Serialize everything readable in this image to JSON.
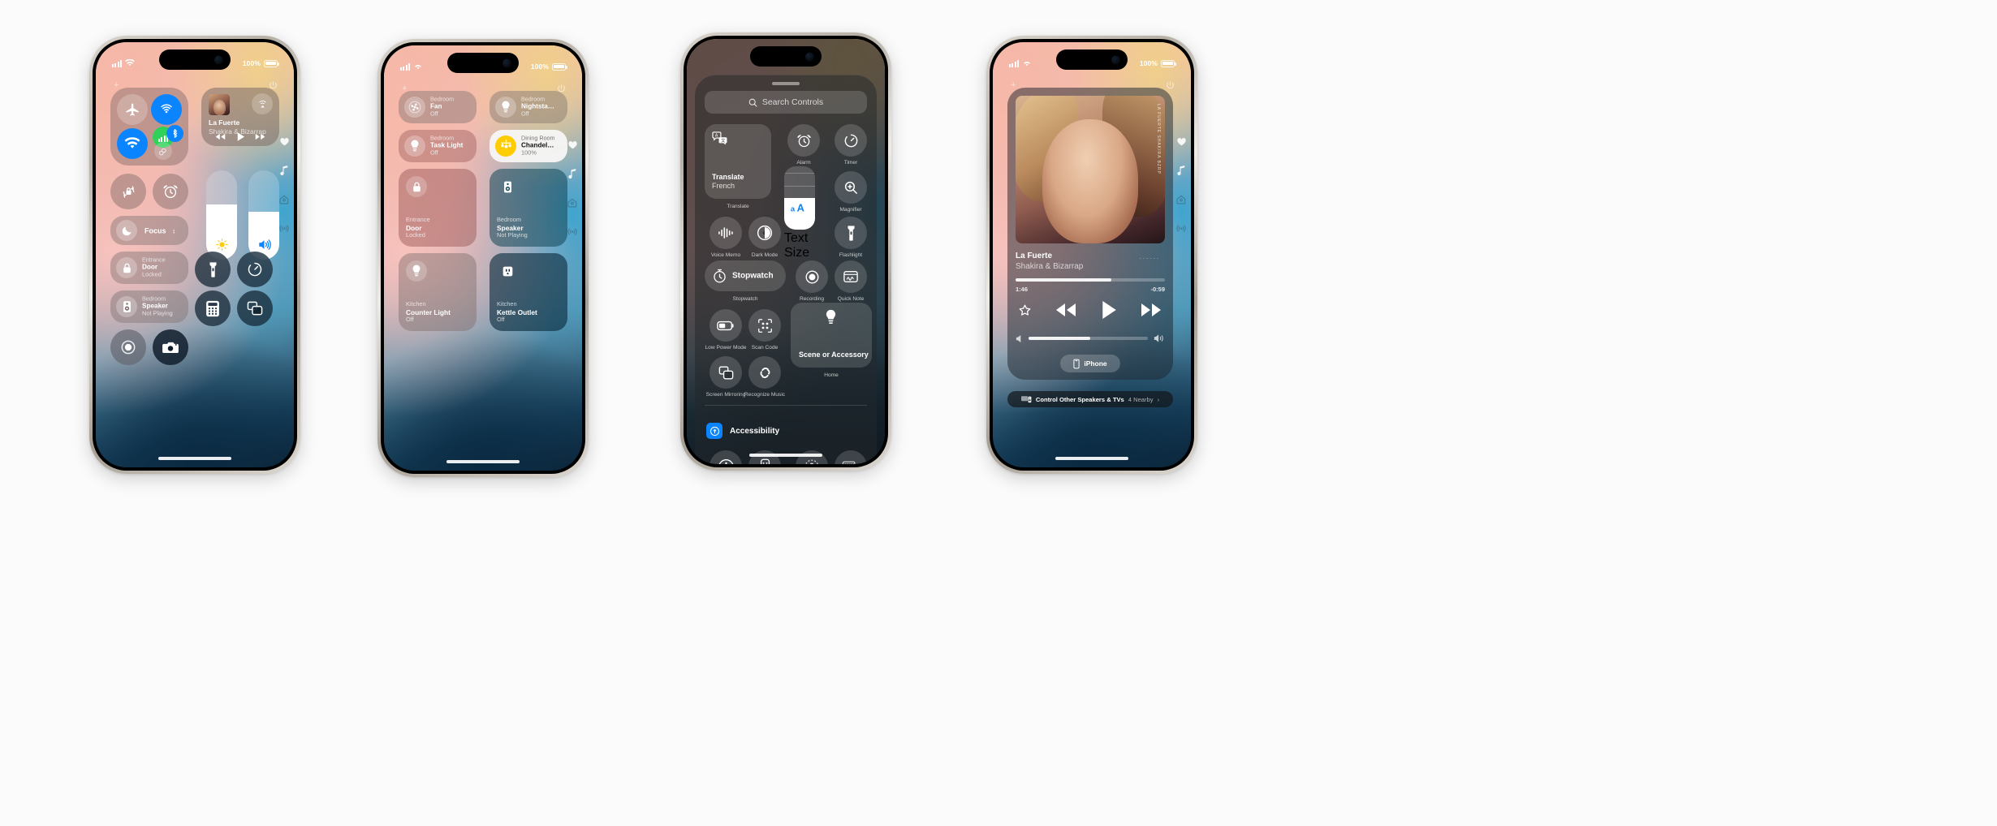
{
  "page": {
    "background": "#fbfbfb",
    "accent_blue": "#0a84ff",
    "accent_green": "#30d158",
    "accent_yellow": "#ffcc00"
  },
  "phones": [
    {
      "id": "phone-1",
      "name": "control-center-default",
      "statusbar": {
        "battery_percent": "100%",
        "signal": "cellular-bars-icon",
        "wifi": "wifi-icon"
      },
      "connectivity": {
        "airplane": "airplane-mode-icon",
        "airdrop": "airdrop-icon",
        "wifi": "wifi-icon",
        "cellular": "cellular-data-icon",
        "bluetooth": "bluetooth-icon",
        "hotspot": "personal-hotspot-icon"
      },
      "now_playing": {
        "title": "La Fuerte",
        "artist": "Shakira & Bizarrap",
        "airplay_icon": "airplay-audio-icon",
        "prev_label": "rewind",
        "play_label": "play",
        "next_label": "fast-forward"
      },
      "quick_toggles": [
        {
          "name": "rotation-lock",
          "icon": "rotation-lock-icon"
        },
        {
          "name": "alarm",
          "icon": "alarm-clock-icon"
        }
      ],
      "focus": {
        "label": "Focus",
        "icon": "moon-icon"
      },
      "sliders": {
        "brightness_icon": "sun-icon",
        "brightness_value": 62,
        "volume_icon": "speaker-waves-icon",
        "volume_value": 54
      },
      "home_controls": [
        {
          "room": "Entrance",
          "name": "Door",
          "state": "Locked",
          "icon": "lock-icon"
        },
        {
          "room": "Bedroom",
          "name": "Speaker",
          "state": "Not Playing",
          "icon": "homepod-speaker-icon"
        }
      ],
      "utility": [
        {
          "name": "flashlight",
          "icon": "flashlight-icon"
        },
        {
          "name": "timer",
          "icon": "timer-icon"
        },
        {
          "name": "calculator",
          "icon": "calculator-icon"
        },
        {
          "name": "screen-mirroring",
          "icon": "screen-mirroring-icon"
        },
        {
          "name": "screen-recording",
          "icon": "screen-record-icon"
        },
        {
          "name": "camera",
          "icon": "camera-icon"
        }
      ],
      "rail": [
        "favorites-heart-icon",
        "music-note-icon",
        "home-icon",
        "connectivity-airplay-icon"
      ]
    },
    {
      "id": "phone-2",
      "name": "control-center-home-page",
      "statusbar": {
        "battery_percent": "100%"
      },
      "tiles_small": [
        {
          "room": "Bedroom",
          "name": "Fan",
          "state": "Off",
          "icon": "fan-icon",
          "on": false
        },
        {
          "room": "Bedroom",
          "name": "Nightsta…",
          "state": "Off",
          "icon": "lightbulb-icon",
          "on": false
        },
        {
          "room": "Bedroom",
          "name": "Task Light",
          "state": "Off",
          "icon": "lightbulb-icon",
          "on": false
        },
        {
          "room": "Dining Room",
          "name": "Chandel…",
          "state": "100%",
          "icon": "chandelier-icon",
          "on": true
        }
      ],
      "tiles_large": [
        {
          "room": "Entrance",
          "name": "Door",
          "state": "Locked",
          "icon": "lock-icon"
        },
        {
          "room": "Bedroom",
          "name": "Speaker",
          "state": "Not Playing",
          "icon": "homepod-speaker-icon"
        },
        {
          "room": "Kitchen",
          "name": "Counter Light",
          "state": "Off",
          "icon": "lightbulb-icon"
        },
        {
          "room": "Kitchen",
          "name": "Kettle Outlet",
          "state": "Off",
          "icon": "power-outlet-icon"
        }
      ],
      "rail": [
        "favorites-heart-icon",
        "music-note-icon",
        "home-icon",
        "connectivity-airplay-icon"
      ]
    },
    {
      "id": "phone-3",
      "name": "controls-gallery",
      "search": {
        "placeholder": "Search Controls",
        "icon": "search-icon"
      },
      "gallery": {
        "translate": {
          "title": "Translate",
          "subtitle": "French",
          "caption": "Translate",
          "icon": "translate-icon"
        },
        "items": [
          {
            "label": "Alarm",
            "icon": "alarm-clock-icon"
          },
          {
            "label": "Timer",
            "icon": "timer-icon"
          },
          {
            "label": "Magnifier",
            "icon": "magnifier-icon"
          },
          {
            "label": "Voice Memo",
            "icon": "waveform-icon"
          },
          {
            "label": "Dark Mode",
            "icon": "dark-mode-icon"
          },
          {
            "label": "Text Size",
            "icon": "text-size-icon"
          },
          {
            "label": "Flashlight",
            "icon": "flashlight-icon"
          },
          {
            "label": "Recording",
            "icon": "screen-record-icon"
          },
          {
            "label": "Quick Note",
            "icon": "quick-note-icon"
          },
          {
            "label": "Low Power Mode",
            "icon": "low-battery-icon"
          },
          {
            "label": "Scan Code",
            "icon": "qr-scan-icon"
          },
          {
            "label": "Screen Mirroring",
            "icon": "screen-mirroring-icon"
          },
          {
            "label": "Recognize Music",
            "icon": "shazam-icon"
          }
        ],
        "stopwatch": {
          "label": "Stopwatch",
          "caption": "Stopwatch",
          "icon": "stopwatch-icon"
        },
        "scene": {
          "label": "Scene or Accessory",
          "caption": "Home",
          "icon": "lightbulb-icon"
        }
      },
      "section": {
        "title": "Accessibility",
        "icon": "accessibility-badge-icon",
        "items": [
          {
            "name": "assistive-touch",
            "icon": "accessibility-person-icon"
          },
          {
            "name": "apple-tv-remote",
            "icon": "remote-icon"
          },
          {
            "name": "guided-access",
            "icon": "guided-access-lock-icon"
          },
          {
            "name": "live-speech",
            "icon": "keyboard-speech-icon"
          }
        ]
      }
    },
    {
      "id": "phone-4",
      "name": "now-playing-expanded",
      "statusbar": {
        "battery_percent": "100%"
      },
      "now_playing": {
        "title": "La Fuerte",
        "artist": "Shakira & Bizarrap",
        "cover_text": "LA FUERTE  SHAKIRA  BZRP",
        "elapsed": "1:46",
        "remaining": "-0:59",
        "progress_percent": 64,
        "volume_percent": 52,
        "favorite_icon": "star-icon",
        "prev_icon": "rewind-icon",
        "play_icon": "play-icon",
        "next_icon": "fast-forward-icon",
        "more_icon": "more-dots-icon",
        "device": {
          "label": "iPhone",
          "icon": "iphone-icon"
        }
      },
      "control_others": {
        "label": "Control Other Speakers & TVs",
        "count": "4 Nearby",
        "chevron": "chevron-right-icon",
        "icon": "speaker-tv-icon"
      },
      "rail": [
        "favorites-heart-icon",
        "music-note-icon",
        "home-icon",
        "connectivity-airplay-icon"
      ]
    }
  ]
}
